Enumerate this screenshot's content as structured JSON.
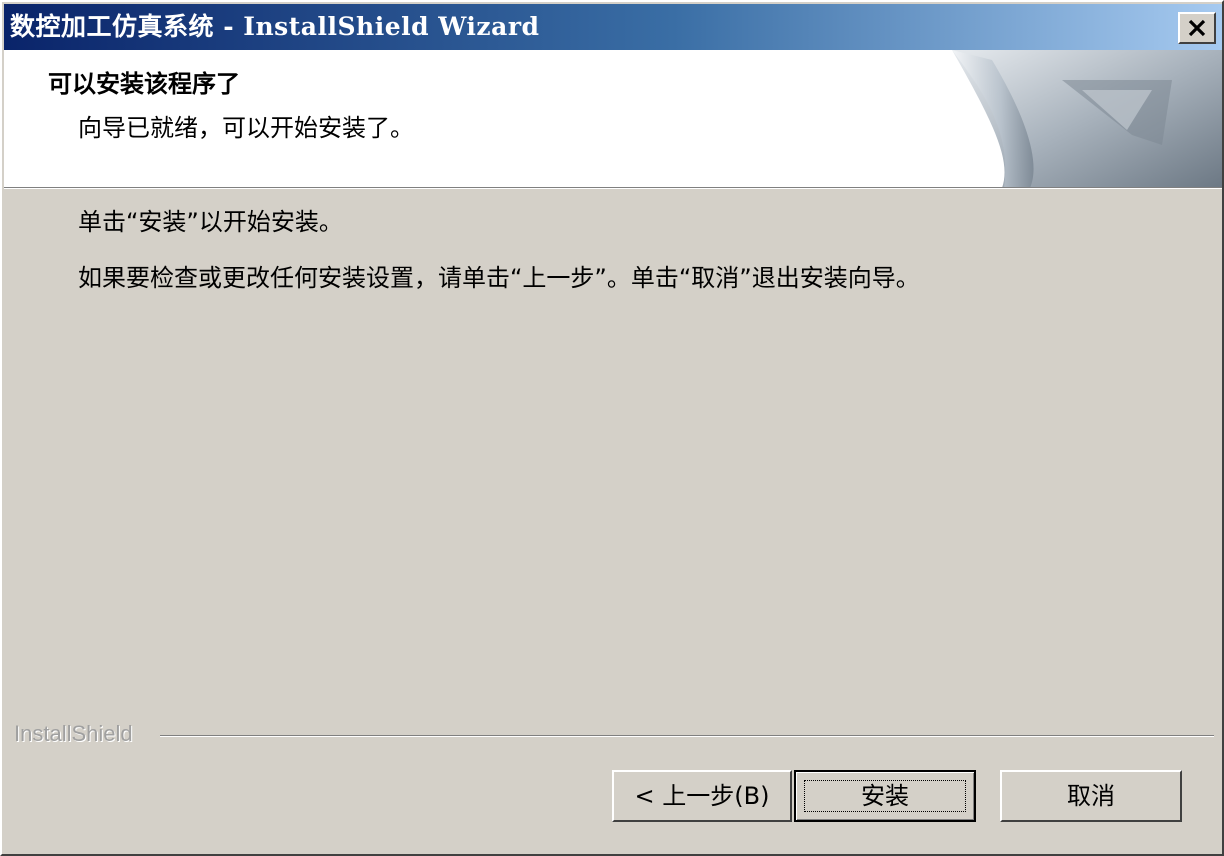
{
  "window": {
    "title": "数控加工仿真系统 - InstallShield Wizard"
  },
  "header": {
    "title": "可以安装该程序了",
    "subtitle": "向导已就绪，可以开始安装了。"
  },
  "body": {
    "line1": "单击“安装”以开始安装。",
    "line2": "如果要检查或更改任何安装设置，请单击“上一步”。单击“取消”退出安装向导。"
  },
  "footer": {
    "brand": "InstallShield"
  },
  "buttons": {
    "back_label": "< 上一步(B)",
    "install_label": "安装",
    "cancel_label": "取消"
  },
  "colors": {
    "titlebar_start": "#0a246a",
    "titlebar_end": "#a6caf0",
    "dialog_bg": "#d4d0c8",
    "header_bg": "#ffffff"
  },
  "icons": {
    "close": "close-icon",
    "header_graphic": "page-curl-graphic"
  }
}
